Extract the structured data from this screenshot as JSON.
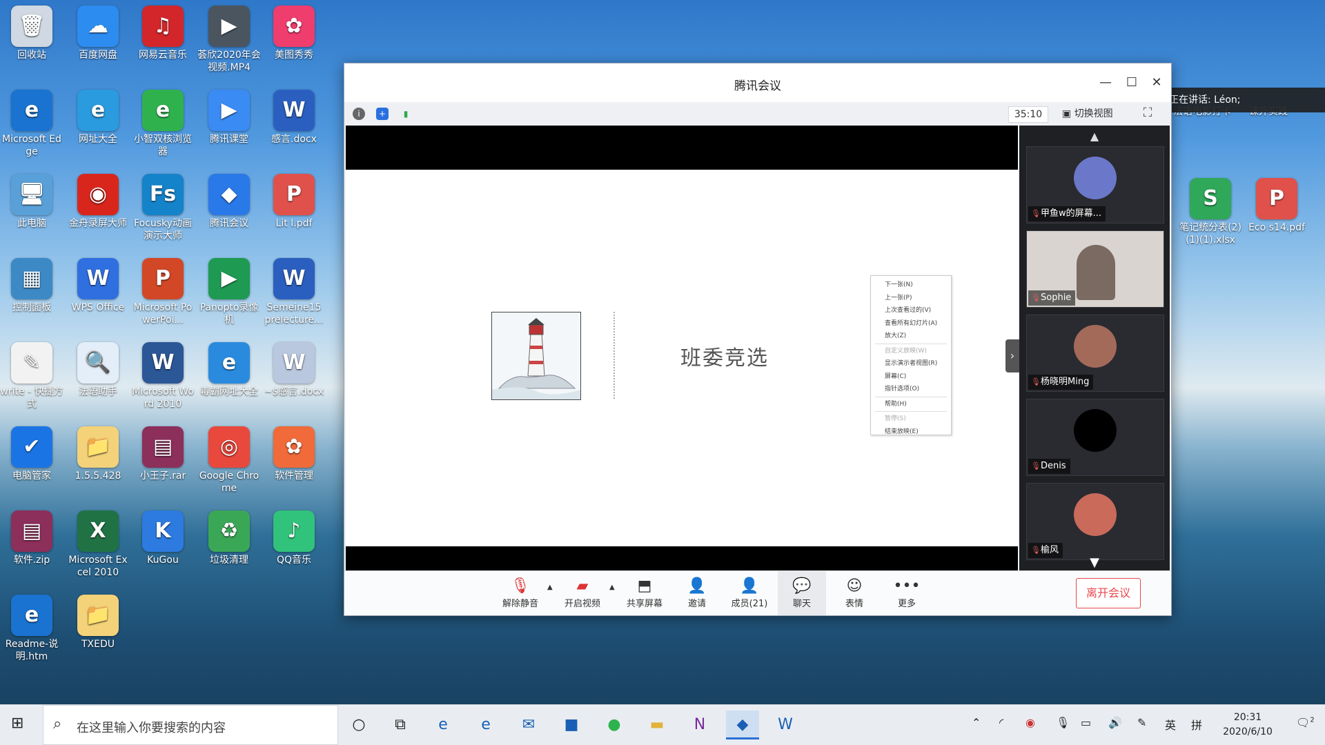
{
  "desktop": {
    "icons": [
      {
        "label": "回收站",
        "glyph": "🗑",
        "color": "#cfd8e3"
      },
      {
        "label": "百度网盘",
        "glyph": "☁",
        "color": "#2d8cf0"
      },
      {
        "label": "网易云音乐",
        "glyph": "♫",
        "color": "#d3262b"
      },
      {
        "label": "荟欣2020年会视频.MP4",
        "glyph": "▶",
        "color": "#4a5560"
      },
      {
        "label": "美图秀秀",
        "glyph": "✿",
        "color": "#ef3d6e"
      },
      {
        "label": "Microsoft Edge",
        "glyph": "e",
        "color": "#1a73d0"
      },
      {
        "label": "网址大全",
        "glyph": "e",
        "color": "#2a9bde"
      },
      {
        "label": "小智双核浏览器",
        "glyph": "e",
        "color": "#2fb24d"
      },
      {
        "label": "腾讯课堂",
        "glyph": "▶",
        "color": "#3b8bf5"
      },
      {
        "label": "感言.docx",
        "glyph": "W",
        "color": "#2b5fbf"
      },
      {
        "label": "此电脑",
        "glyph": "🖥",
        "color": "#5aa0d8"
      },
      {
        "label": "金舟录屏大师",
        "glyph": "◉",
        "color": "#d9261c"
      },
      {
        "label": "Focusky动画演示大师",
        "glyph": "Fs",
        "color": "#1583c9"
      },
      {
        "label": "腾讯会议",
        "glyph": "◆",
        "color": "#2a79e8"
      },
      {
        "label": "Lit I.pdf",
        "glyph": "P",
        "color": "#e0514b"
      },
      {
        "label": "控制面板",
        "glyph": "▦",
        "color": "#3c89c6"
      },
      {
        "label": "WPS Office",
        "glyph": "W",
        "color": "#2f6fe0"
      },
      {
        "label": "Microsoft PowerPoi...",
        "glyph": "P",
        "color": "#d24726"
      },
      {
        "label": "Panopto录像机",
        "glyph": "▶",
        "color": "#1e9a52"
      },
      {
        "label": "Semeine15 prelecture...",
        "glyph": "W",
        "color": "#2b5fbf"
      },
      {
        "label": "write - 快捷方式",
        "glyph": "✎",
        "color": "#f2f2f2"
      },
      {
        "label": "法语助手",
        "glyph": "🔍",
        "color": "#e4eef8"
      },
      {
        "label": "Microsoft Word 2010",
        "glyph": "W",
        "color": "#2b5797"
      },
      {
        "label": "毒霸网址大全",
        "glyph": "e",
        "color": "#2a8bde"
      },
      {
        "label": "~$感言.docx",
        "glyph": "W",
        "color": "#b9c7df"
      },
      {
        "label": "电脑管家",
        "glyph": "✔",
        "color": "#1b74e4"
      },
      {
        "label": "1.5.5.428",
        "glyph": "📁",
        "color": "#f3d27a"
      },
      {
        "label": "小王子.rar",
        "glyph": "▤",
        "color": "#8c2f5b"
      },
      {
        "label": "Google Chrome",
        "glyph": "◎",
        "color": "#e9483c"
      },
      {
        "label": "软件管理",
        "glyph": "✿",
        "color": "#f06a3a"
      },
      {
        "label": "软件.zip",
        "glyph": "▤",
        "color": "#8c2f5b"
      },
      {
        "label": "Microsoft Excel 2010",
        "glyph": "X",
        "color": "#207245"
      },
      {
        "label": "KuGou",
        "glyph": "K",
        "color": "#2d7be0"
      },
      {
        "label": "垃圾清理",
        "glyph": "♻",
        "color": "#3aa757"
      },
      {
        "label": "QQ音乐",
        "glyph": "♪",
        "color": "#31c27c"
      },
      {
        "label": "Readme-说明.htm",
        "glyph": "e",
        "color": "#1a73d0"
      },
      {
        "label": "TXEDU",
        "glyph": "📁",
        "color": "#f3d27a"
      }
    ],
    "right_icons": [
      {
        "label": "法语电影打卡",
        "glyph": "📁",
        "color": "#f3d27a"
      },
      {
        "label": "课外实践",
        "glyph": "📁",
        "color": "#f3d27a"
      },
      {
        "label": "笔记统分表(2)(1)(1).xlsx",
        "glyph": "S",
        "color": "#2fa85a"
      },
      {
        "label": "Eco s14.pdf",
        "glyph": "P",
        "color": "#e0514b"
      }
    ]
  },
  "meeting": {
    "title": "腾讯会议",
    "timer": "35:10",
    "switch_view": "切换视图",
    "slide": {
      "title": "班委竞选",
      "menu": [
        {
          "label": "下一张(N)",
          "disabled": false
        },
        {
          "label": "上一张(P)",
          "disabled": false
        },
        {
          "label": "上次查看过的(V)",
          "disabled": false
        },
        {
          "label": "查看所有幻灯片(A)",
          "disabled": false
        },
        {
          "label": "放大(Z)",
          "disabled": false
        },
        {
          "label": "自定义放映(W)",
          "disabled": true
        },
        {
          "label": "显示演示者视图(R)",
          "disabled": false
        },
        {
          "label": "屏幕(C)",
          "disabled": false
        },
        {
          "label": "指针选项(O)",
          "disabled": false
        },
        {
          "label": "帮助(H)",
          "disabled": false
        },
        {
          "label": "暂停(S)",
          "disabled": true
        },
        {
          "label": "结束放映(E)",
          "disabled": false
        }
      ]
    },
    "participants": [
      {
        "name": "甲鱼w的屏幕...",
        "avatar": "#6b77c9"
      },
      {
        "name": "Sophie",
        "avatar": "#7a6a62"
      },
      {
        "name": "杨晓明Ming",
        "avatar": "#a36a5a"
      },
      {
        "name": "Denis",
        "avatar": "#000000"
      },
      {
        "name": "榆风",
        "avatar": "#c96a5a"
      }
    ],
    "toolbar": {
      "mute": "解除静音",
      "video": "开启视频",
      "share": "共享屏幕",
      "invite": "邀请",
      "members": "成员(21)",
      "chat": "聊天",
      "emoji": "表情",
      "more": "更多",
      "leave": "离开会议"
    },
    "speaking": "正在讲话: Léon;"
  },
  "taskbar": {
    "search_placeholder": "在这里输入你要搜索的内容",
    "ime": "英",
    "ime2": "拼",
    "time": "20:31",
    "date": "2020/6/10",
    "notifications": "2"
  }
}
